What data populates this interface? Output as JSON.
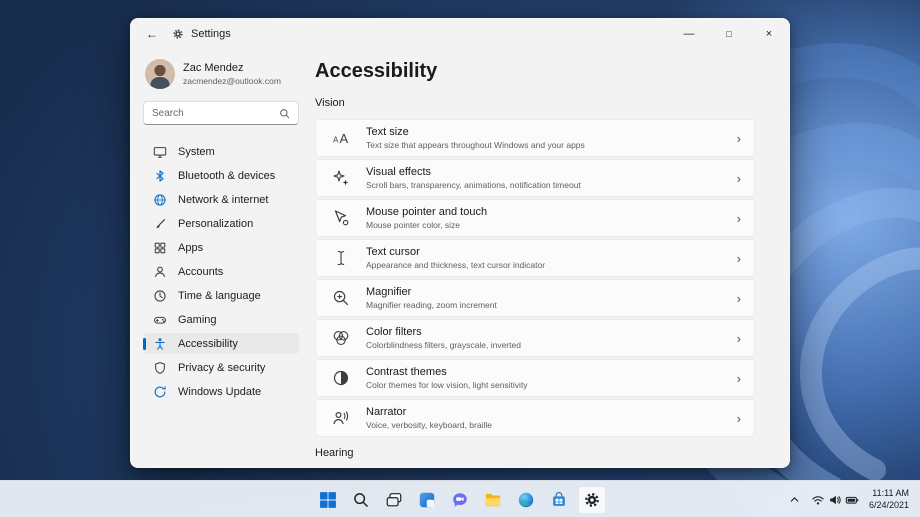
{
  "colors": {
    "accent": "#0067c0",
    "window_bg": "#f3f3f3",
    "card_bg": "#fbfbfb",
    "taskbar_bg": "#f1f5fb",
    "desktop_blue": "#24426e"
  },
  "titlebar": {
    "title": "Settings"
  },
  "icons": {
    "back": "←",
    "minimize": "—",
    "maximize": "□",
    "close": "×",
    "chevron_right": "›"
  },
  "user": {
    "name": "Zac Mendez",
    "email": "zacmendez@outlook.com"
  },
  "search": {
    "placeholder": "Search"
  },
  "sidebar": {
    "items": [
      {
        "label": "System"
      },
      {
        "label": "Bluetooth & devices"
      },
      {
        "label": "Network & internet"
      },
      {
        "label": "Personalization"
      },
      {
        "label": "Apps"
      },
      {
        "label": "Accounts"
      },
      {
        "label": "Time & language"
      },
      {
        "label": "Gaming"
      },
      {
        "label": "Accessibility",
        "selected": true
      },
      {
        "label": "Privacy & security"
      },
      {
        "label": "Windows Update"
      }
    ]
  },
  "page": {
    "title": "Accessibility",
    "sections": {
      "vision": "Vision",
      "hearing": "Hearing"
    },
    "cards": [
      {
        "title": "Text size",
        "subtitle": "Text size that appears throughout Windows and your apps"
      },
      {
        "title": "Visual effects",
        "subtitle": "Scroll bars, transparency, animations, notification timeout"
      },
      {
        "title": "Mouse pointer and touch",
        "subtitle": "Mouse pointer color, size"
      },
      {
        "title": "Text cursor",
        "subtitle": "Appearance and thickness, text cursor indicator"
      },
      {
        "title": "Magnifier",
        "subtitle": "Magnifier reading, zoom increment"
      },
      {
        "title": "Color filters",
        "subtitle": "Colorblindness filters, grayscale, inverted"
      },
      {
        "title": "Contrast themes",
        "subtitle": "Color themes for low vision, light sensitivity"
      },
      {
        "title": "Narrator",
        "subtitle": "Voice, verbosity, keyboard, braille"
      }
    ]
  },
  "taskbar": {
    "time": "11:11 AM",
    "date": "6/24/2021"
  }
}
